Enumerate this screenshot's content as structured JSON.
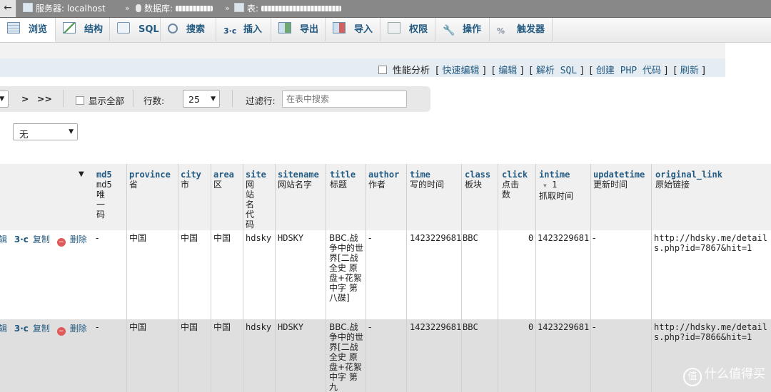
{
  "breadcrumb": {
    "server_label": "服务器: localhost",
    "database_label": "数据库:",
    "table_label": "表:",
    "separator": "»"
  },
  "tabs": [
    {
      "label": "浏览",
      "icon": "browse-icon"
    },
    {
      "label": "结构",
      "icon": "structure-icon"
    },
    {
      "label": "SQL",
      "icon": "sql-icon"
    },
    {
      "label": "搜索",
      "icon": "search-icon"
    },
    {
      "label": "插入",
      "icon": "insert-icon"
    },
    {
      "label": "导出",
      "icon": "export-icon"
    },
    {
      "label": "导入",
      "icon": "import-icon"
    },
    {
      "label": "权限",
      "icon": "privileges-icon"
    },
    {
      "label": "操作",
      "icon": "wrench-icon"
    },
    {
      "label": "触发器",
      "icon": "triggers-icon"
    }
  ],
  "query_actions": {
    "profiling": "性能分析",
    "quick_edit": "快速编辑",
    "edit": "编辑",
    "explain_sql": "解析 SQL",
    "create_php": "创建 PHP 代码",
    "refresh": "刷新"
  },
  "navigation": {
    "next": ">",
    "last": ">>",
    "show_all": "显示全部",
    "rows_label": "行数:",
    "rows_value": "25",
    "filter_label": "过滤行:",
    "filter_placeholder": "在表中搜索"
  },
  "sort_select": {
    "value": "无"
  },
  "columns": [
    {
      "en": "md5",
      "zh": "md5 唯一码"
    },
    {
      "en": "province",
      "zh": "省"
    },
    {
      "en": "city",
      "zh": "市"
    },
    {
      "en": "area",
      "zh": "区"
    },
    {
      "en": "site",
      "zh": "网站名代码"
    },
    {
      "en": "sitename",
      "zh": "网站名字"
    },
    {
      "en": "title",
      "zh": "标题"
    },
    {
      "en": "author",
      "zh": "作者"
    },
    {
      "en": "time",
      "zh": "写的时间"
    },
    {
      "en": "class",
      "zh": "板块"
    },
    {
      "en": "click",
      "zh": "点击数"
    },
    {
      "en": "intime",
      "zh": "抓取时间",
      "sort_indicator": "1"
    },
    {
      "en": "updatetime",
      "zh": "更新时间"
    },
    {
      "en": "original_link",
      "zh": "原始链接"
    }
  ],
  "row_actions": {
    "edit": "编辑",
    "copy": "复制",
    "delete": "删除"
  },
  "rows": [
    {
      "md5": "-",
      "province": "中国",
      "city": "中国",
      "area": "中国",
      "site": "hdsky",
      "sitename": "HDSKY",
      "title": "BBC.战争中的世界[二战全史 原盘+花絮中字 第八碟]",
      "author": "-",
      "time": "1423229681",
      "class": "BBC",
      "click": "0",
      "intime": "1423229681",
      "updatetime": "-",
      "original_link": "http://hdsky.me/details.php?id=7867&hit=1"
    },
    {
      "md5": "-",
      "province": "中国",
      "city": "中国",
      "area": "中国",
      "site": "hdsky",
      "sitename": "HDSKY",
      "title": "BBC.战争中的世界[二战全史 原盘+花絮中字 第九",
      "author": "-",
      "time": "1423229681",
      "class": "BBC",
      "click": "0",
      "intime": "1423229681",
      "updatetime": "-",
      "original_link": "http://hdsky.me/details.php?id=7866&hit=1"
    }
  ],
  "watermark": {
    "text": "什么值得买",
    "logo": "值"
  }
}
